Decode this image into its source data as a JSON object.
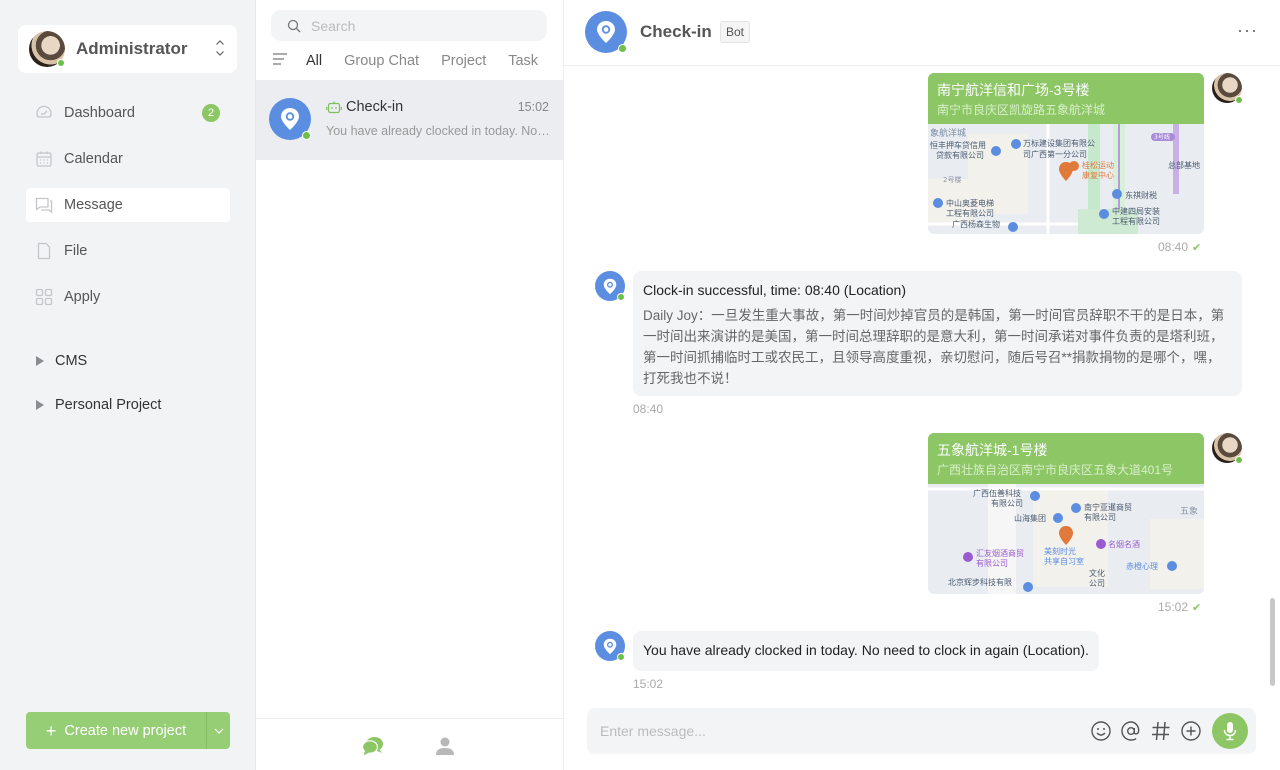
{
  "user": {
    "name": "Administrator",
    "status": "online"
  },
  "sidebar": {
    "items": [
      {
        "label": "Dashboard",
        "icon": "dashboard-icon",
        "badge": "2"
      },
      {
        "label": "Calendar",
        "icon": "calendar-icon"
      },
      {
        "label": "Message",
        "icon": "message-icon",
        "active": true
      },
      {
        "label": "File",
        "icon": "file-icon"
      },
      {
        "label": "Apply",
        "icon": "apps-icon"
      }
    ],
    "tree": [
      {
        "label": "CMS"
      },
      {
        "label": "Personal Project"
      }
    ],
    "create_button": {
      "label": "Create new project",
      "icon": "plus-icon"
    }
  },
  "conversations": {
    "search_placeholder": "Search",
    "tabs": [
      "All",
      "Group Chat",
      "Project",
      "Task"
    ],
    "active_tab": "All",
    "items": [
      {
        "title": "Check-in",
        "time": "15:02",
        "preview": "You have already clocked in today. No need to clock in again (Location).",
        "is_bot": true
      }
    ]
  },
  "chat": {
    "title": "Check-in",
    "tag": "Bot",
    "more_label": "···",
    "messages": [
      {
        "type": "location",
        "from": "self",
        "name": "南宁航洋信和广场-3号楼",
        "address": "南宁市良庆区凯旋路五象航洋城",
        "time": "08:40",
        "read": true,
        "map_labels": [
          "象航洋城",
          "恒丰押车贷信用贷款有限公司",
          "万标建设集团有限公司广西第一分公司",
          "桂松运动康复中心",
          "3号线",
          "总部基地",
          "2号楼",
          "东祺财税",
          "中山奥菱电梯工程有限公司",
          "中建四局安装工程有限公司",
          "广西杨森生物药业有限公司"
        ]
      },
      {
        "type": "text",
        "from": "bot",
        "title": "Clock-in successful, time: 08:40 (Location)",
        "body": "Daily Joy：一旦发生重大事故，第一时间炒掉官员的是韩国，第一时间官员辞职不干的是日本，第一时间出来演讲的是美国，第一时间总理辞职的是意大利，第一时间承诺对事件负责的是塔利班，第一时间抓捕临时工或农民工，且领导高度重视，亲切慰问，随后号召**捐款捐物的是哪个，嘿，打死我也不说！",
        "time": "08:40"
      },
      {
        "type": "location",
        "from": "self",
        "name": "五象航洋城-1号楼",
        "address": "广西壮族自治区南宁市良庆区五象大道401号",
        "time": "15:02",
        "read": true,
        "map_labels": [
          "广西伍善科技有限公司",
          "南宁亚暹商贸有限公司",
          "山海集团",
          "五象",
          "美刻时光共享自习室",
          "名烟名酒",
          "汇友烟酒商贸有限公司",
          "赤橙心理",
          "文化公司",
          "北京辉步科技有限公司广西分公司"
        ]
      },
      {
        "type": "text",
        "from": "bot",
        "title": "You have already clocked in today. No need to clock in again (Location).",
        "time": "15:02"
      }
    ],
    "input_placeholder": "Enter message...",
    "tools": [
      "emoji-icon",
      "mention-icon",
      "topic-icon",
      "add-icon",
      "microphone-icon"
    ]
  },
  "colors": {
    "accent": "#8cc665",
    "bot_avatar": "#5b8de0",
    "online": "#6cc04a"
  }
}
